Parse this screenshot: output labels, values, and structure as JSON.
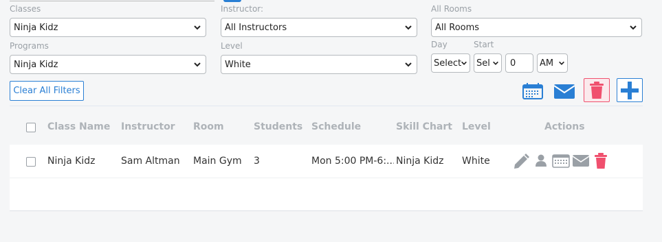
{
  "filters": {
    "classes": {
      "label": "Classes",
      "value": "Ninja Kidz"
    },
    "instructor": {
      "label": "Instructor:",
      "value": "All Instructors"
    },
    "rooms": {
      "label": "All Rooms",
      "value": "All Rooms"
    },
    "programs": {
      "label": "Programs",
      "value": "Ninja Kidz"
    },
    "level": {
      "label": "Level",
      "value": "White"
    },
    "day": {
      "label": "Day",
      "value": "Select"
    },
    "start": {
      "label": "Start",
      "hour": "Sel",
      "minute": "0",
      "ampm": "AM"
    }
  },
  "toolbar": {
    "clear_label": "Clear All Filters",
    "icons": [
      "calendar-icon",
      "email-icon",
      "trash-icon",
      "plus-icon"
    ],
    "colors": {
      "accent": "#2a7fd4",
      "danger": "#f0506e"
    }
  },
  "table": {
    "columns": [
      "Class Name",
      "Instructor",
      "Room",
      "Students",
      "Schedule",
      "Skill Chart",
      "Level",
      "Actions"
    ],
    "rows": [
      {
        "class_name": "Ninja Kidz",
        "instructor": "Sam Altman",
        "room": "Main Gym",
        "students": "3",
        "schedule": "Mon 5:00 PM-6:...",
        "skill_chart": "Ninja Kidz",
        "level": "White",
        "actions": [
          "edit-icon",
          "user-icon",
          "calendar-icon",
          "email-icon",
          "trash-icon"
        ]
      }
    ]
  }
}
